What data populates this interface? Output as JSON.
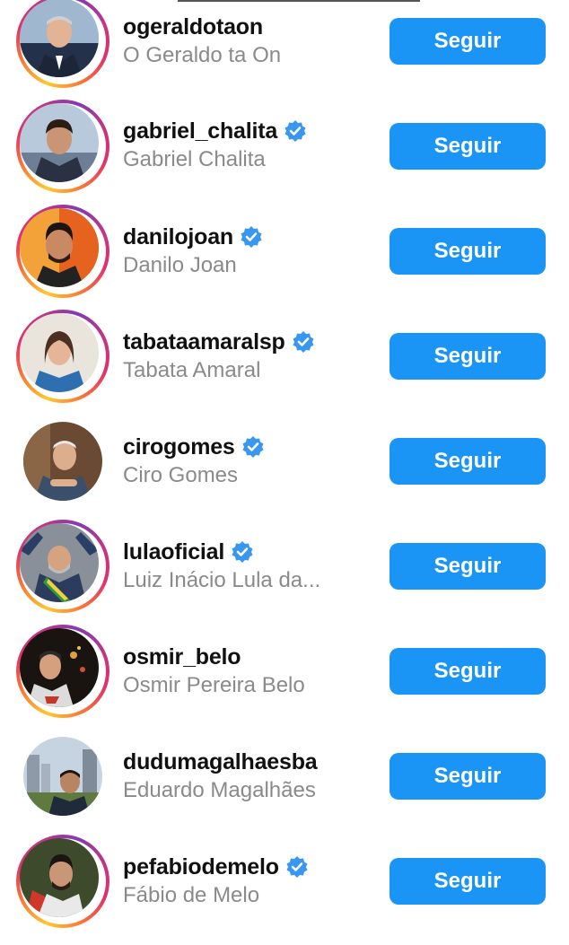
{
  "colors": {
    "button": "#1b95f5",
    "verified": "#3897f0",
    "username": "#111111",
    "fullname": "#8a8a8a"
  },
  "accounts": [
    {
      "username": "ogeraldotaon",
      "name": "O Geraldo ta On",
      "verified": false,
      "story": true,
      "button": "Seguir"
    },
    {
      "username": "gabriel_chalita",
      "name": "Gabriel Chalita",
      "verified": true,
      "story": true,
      "button": "Seguir"
    },
    {
      "username": "danilojoan",
      "name": "Danilo Joan",
      "verified": true,
      "story": true,
      "button": "Seguir"
    },
    {
      "username": "tabataamaralsp",
      "name": "Tabata Amaral",
      "verified": true,
      "story": true,
      "button": "Seguir"
    },
    {
      "username": "cirogomes",
      "name": "Ciro Gomes",
      "verified": true,
      "story": false,
      "button": "Seguir"
    },
    {
      "username": "lulaoficial",
      "name": "Luiz Inácio Lula da...",
      "verified": true,
      "story": true,
      "button": "Seguir"
    },
    {
      "username": "osmir_belo",
      "name": "Osmir Pereira Belo",
      "verified": false,
      "story": true,
      "button": "Seguir"
    },
    {
      "username": "dudumagalhaesba",
      "name": "Eduardo Magalhães",
      "verified": false,
      "story": false,
      "button": "Seguir"
    },
    {
      "username": "pefabiodemelo",
      "name": "Fábio de Melo",
      "verified": true,
      "story": true,
      "button": "Seguir"
    }
  ]
}
